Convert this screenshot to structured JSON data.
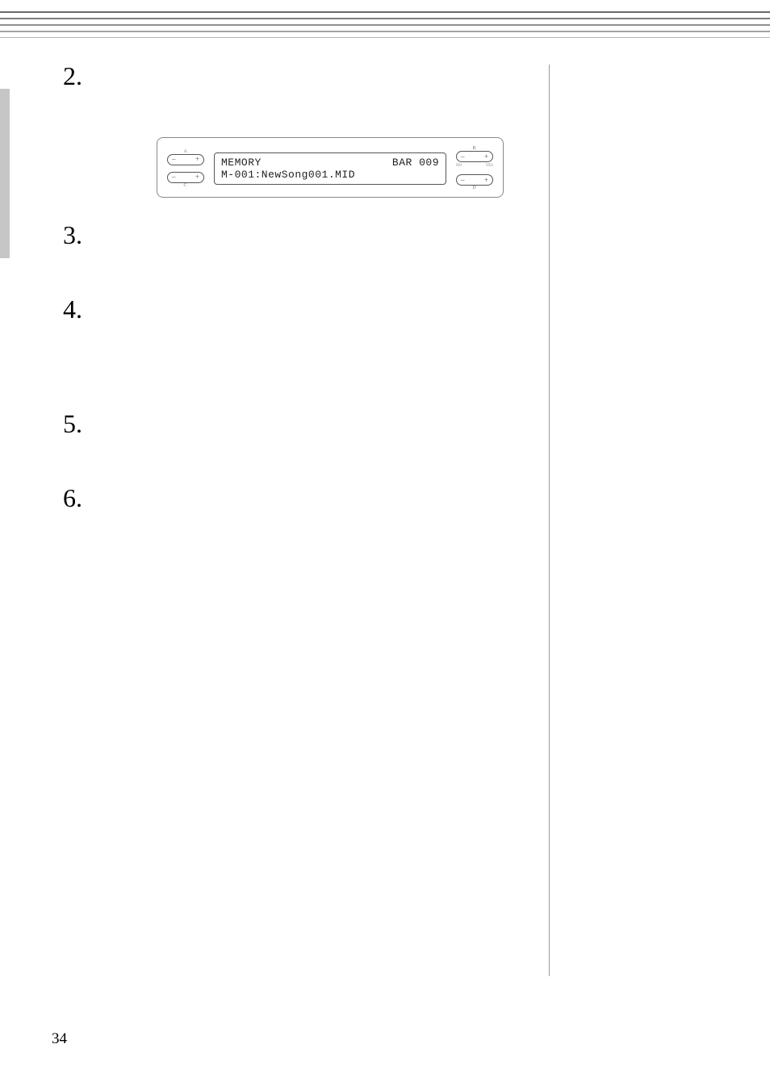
{
  "steps": {
    "s2": "2.",
    "s3": "3.",
    "s4": "4.",
    "s5": "5.",
    "s6": "6."
  },
  "panel": {
    "group_a": "A",
    "group_b": "B",
    "group_c": "C",
    "group_d": "D",
    "minus": "–",
    "plus": "+",
    "no": "NO",
    "yes": "YES",
    "lcd_line1_left": "MEMORY",
    "lcd_line1_right": "BAR 009",
    "lcd_line2": "M-001:NewSong001.MID"
  },
  "page_number": "34"
}
